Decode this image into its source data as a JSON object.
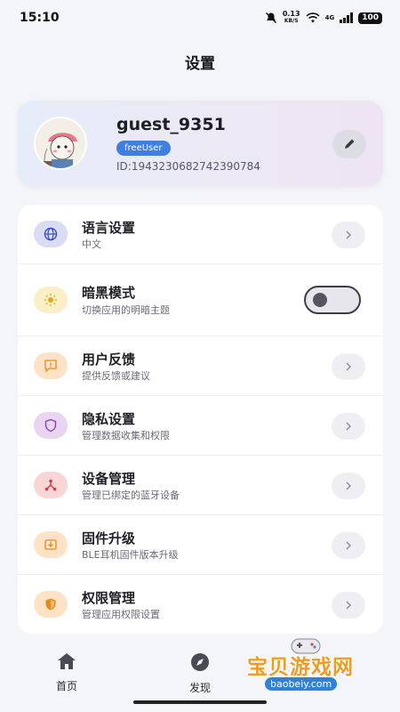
{
  "status_bar": {
    "time": "15:10",
    "net_speed": "0.13",
    "net_unit": "KB/S",
    "network_type": "4G",
    "battery": "100"
  },
  "page": {
    "title": "设置"
  },
  "profile": {
    "username": "guest_9351",
    "badge": "freeUser",
    "id_text": "ID:1943230682742390784",
    "avatar_icon": "avatar-illustration",
    "edit_icon": "pencil-icon"
  },
  "settings": [
    {
      "title": "语言设置",
      "subtitle": "中文",
      "icon": "globe-icon",
      "icon_bg": "#d9dcf2",
      "icon_color": "#3a4dbf",
      "control": "chevron"
    },
    {
      "title": "暗黑模式",
      "subtitle": "切换应用的明暗主题",
      "icon": "sun-icon",
      "icon_bg": "#fbefc7",
      "icon_color": "#e6a417",
      "control": "toggle",
      "toggle_on": false
    },
    {
      "title": "用户反馈",
      "subtitle": "提供反馈或建议",
      "icon": "feedback-icon",
      "icon_bg": "#fde3c6",
      "icon_color": "#e58a1f",
      "control": "chevron"
    },
    {
      "title": "隐私设置",
      "subtitle": "管理数据收集和权限",
      "icon": "shield-icon",
      "icon_bg": "#e8d5ef",
      "icon_color": "#8d3fb0",
      "control": "chevron"
    },
    {
      "title": "设备管理",
      "subtitle": "管理已绑定的蓝牙设备",
      "icon": "device-share-icon",
      "icon_bg": "#f8d6d6",
      "icon_color": "#d6383f",
      "control": "chevron"
    },
    {
      "title": "固件升级",
      "subtitle": "BLE耳机固件版本升级",
      "icon": "download-box-icon",
      "icon_bg": "#fde3c6",
      "icon_color": "#e58a1f",
      "control": "chevron"
    },
    {
      "title": "权限管理",
      "subtitle": "管理应用权限设置",
      "icon": "shield-check-icon",
      "icon_bg": "#fde3c6",
      "icon_color": "#e58a1f",
      "control": "chevron"
    }
  ],
  "bottom_nav": {
    "items": [
      {
        "label": "首页",
        "icon": "home-icon"
      },
      {
        "label": "发现",
        "icon": "compass-icon"
      }
    ]
  },
  "watermark": {
    "title": "宝贝游戏网",
    "url": "baobeiy.com"
  }
}
